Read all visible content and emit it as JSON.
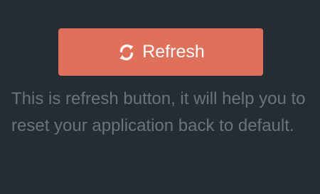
{
  "refresh_button": {
    "label": "Refresh",
    "icon": "refresh-icon",
    "color": "#e07059",
    "text_color": "#ffffff"
  },
  "description": {
    "text": "This is refresh button, it will help you to reset your application back to default."
  },
  "theme": {
    "background": "#232d33",
    "muted_text": "#6b7479"
  }
}
